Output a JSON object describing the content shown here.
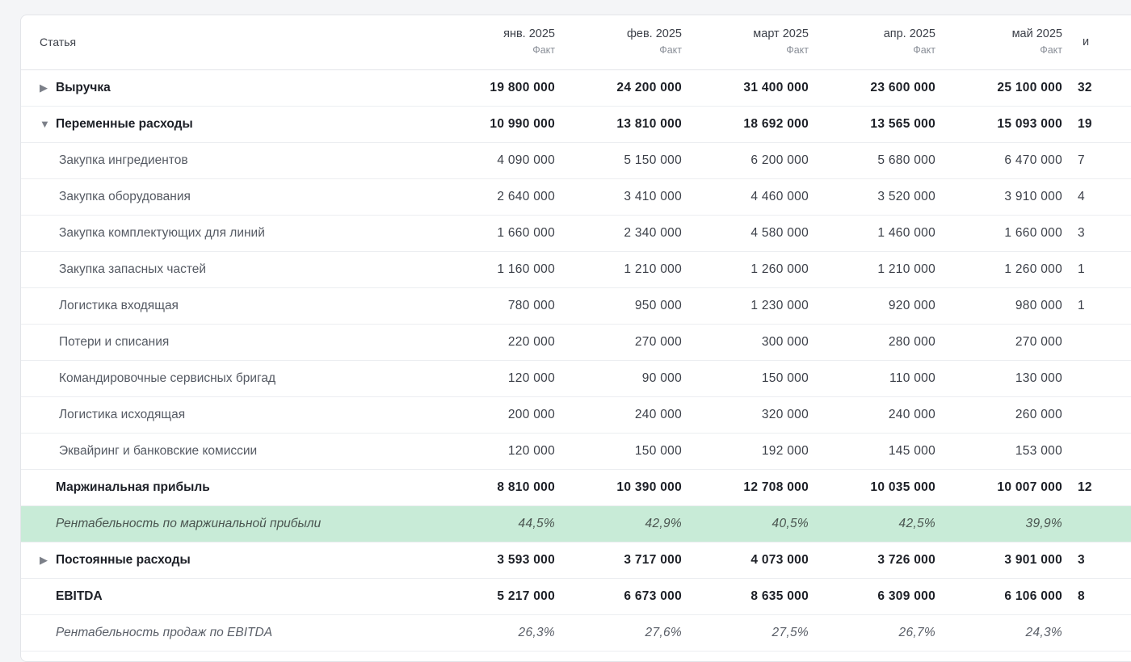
{
  "table": {
    "header_label": "Статья",
    "columns": [
      {
        "month": "янв. 2025",
        "kind": "Факт"
      },
      {
        "month": "фев. 2025",
        "kind": "Факт"
      },
      {
        "month": "март 2025",
        "kind": "Факт"
      },
      {
        "month": "апр. 2025",
        "kind": "Факт"
      },
      {
        "month": "май 2025",
        "kind": "Факт"
      },
      {
        "month": "и",
        "kind": ""
      }
    ],
    "rows": [
      {
        "label": "Выручка",
        "style": "bold",
        "expander": "collapsed",
        "values": [
          "19 800 000",
          "24 200 000",
          "31 400 000",
          "23 600 000",
          "25 100 000",
          "32"
        ]
      },
      {
        "label": "Переменные расходы",
        "style": "bold",
        "expander": "expanded",
        "values": [
          "10 990 000",
          "13 810 000",
          "18 692 000",
          "13 565 000",
          "15 093 000",
          "19"
        ]
      },
      {
        "label": "Закупка ингредиентов",
        "style": "child",
        "expander": "",
        "values": [
          "4 090 000",
          "5 150 000",
          "6 200 000",
          "5 680 000",
          "6 470 000",
          "7"
        ]
      },
      {
        "label": "Закупка оборудования",
        "style": "child",
        "expander": "",
        "values": [
          "2 640 000",
          "3 410 000",
          "4 460 000",
          "3 520 000",
          "3 910 000",
          "4"
        ]
      },
      {
        "label": "Закупка комплектующих для линий",
        "style": "child",
        "expander": "",
        "values": [
          "1 660 000",
          "2 340 000",
          "4 580 000",
          "1 460 000",
          "1 660 000",
          "3"
        ]
      },
      {
        "label": "Закупка запасных частей",
        "style": "child",
        "expander": "",
        "values": [
          "1 160 000",
          "1 210 000",
          "1 260 000",
          "1 210 000",
          "1 260 000",
          "1"
        ]
      },
      {
        "label": "Логистика входящая",
        "style": "child",
        "expander": "",
        "values": [
          "780 000",
          "950 000",
          "1 230 000",
          "920 000",
          "980 000",
          "1"
        ]
      },
      {
        "label": "Потери и списания",
        "style": "child",
        "expander": "",
        "values": [
          "220 000",
          "270 000",
          "300 000",
          "280 000",
          "270 000",
          ""
        ]
      },
      {
        "label": "Командировочные сервисных бригад",
        "style": "child",
        "expander": "",
        "values": [
          "120 000",
          "90 000",
          "150 000",
          "110 000",
          "130 000",
          ""
        ]
      },
      {
        "label": "Логистика исходящая",
        "style": "child",
        "expander": "",
        "values": [
          "200 000",
          "240 000",
          "320 000",
          "240 000",
          "260 000",
          ""
        ]
      },
      {
        "label": "Эквайринг и банковские комиссии",
        "style": "child",
        "expander": "",
        "values": [
          "120 000",
          "150 000",
          "192 000",
          "145 000",
          "153 000",
          ""
        ]
      },
      {
        "label": "Маржинальная прибыль",
        "style": "bold",
        "expander": "none",
        "values": [
          "8 810 000",
          "10 390 000",
          "12 708 000",
          "10 035 000",
          "10 007 000",
          "12"
        ]
      },
      {
        "label": "Рентабельность по маржинальной прибыли",
        "style": "italic-green",
        "expander": "none",
        "values": [
          "44,5%",
          "42,9%",
          "40,5%",
          "42,5%",
          "39,9%",
          ""
        ]
      },
      {
        "label": "Постоянные расходы",
        "style": "bold",
        "expander": "collapsed",
        "values": [
          "3 593 000",
          "3 717 000",
          "4 073 000",
          "3 726 000",
          "3 901 000",
          "3"
        ]
      },
      {
        "label": "EBITDA",
        "style": "bold",
        "expander": "none",
        "values": [
          "5 217 000",
          "6 673 000",
          "8 635 000",
          "6 309 000",
          "6 106 000",
          "8"
        ]
      },
      {
        "label": "Рентабельность продаж по EBITDA",
        "style": "italic",
        "expander": "none",
        "values": [
          "26,3%",
          "27,6%",
          "27,5%",
          "26,7%",
          "24,3%",
          ""
        ]
      }
    ]
  },
  "icons": {
    "collapsed": "triangle-right-icon",
    "expanded": "triangle-down-icon"
  },
  "colors": {
    "highlight_row": "#c8ebd7",
    "page_background": "#f4f5f7"
  }
}
